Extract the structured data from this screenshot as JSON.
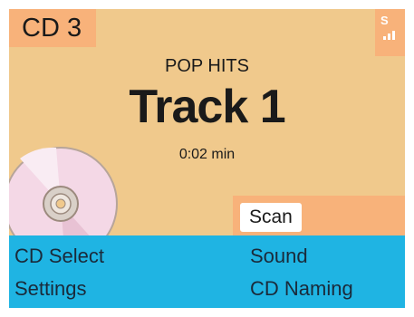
{
  "header": {
    "cd_label": "CD 3",
    "signal_label": "S"
  },
  "now_playing": {
    "playlist": "POP HITS",
    "track": "Track 1",
    "time": "0:02 min"
  },
  "actions": {
    "scan_label": "Scan"
  },
  "menu": {
    "cd_select": "CD Select",
    "sound": "Sound",
    "settings": "Settings",
    "cd_naming": "CD Naming"
  },
  "colors": {
    "display_bg": "#f0c98c",
    "accent_orange": "#f8b27a",
    "menu_blue": "#1fb4e3",
    "disc_pink": "#f4d8e6"
  }
}
